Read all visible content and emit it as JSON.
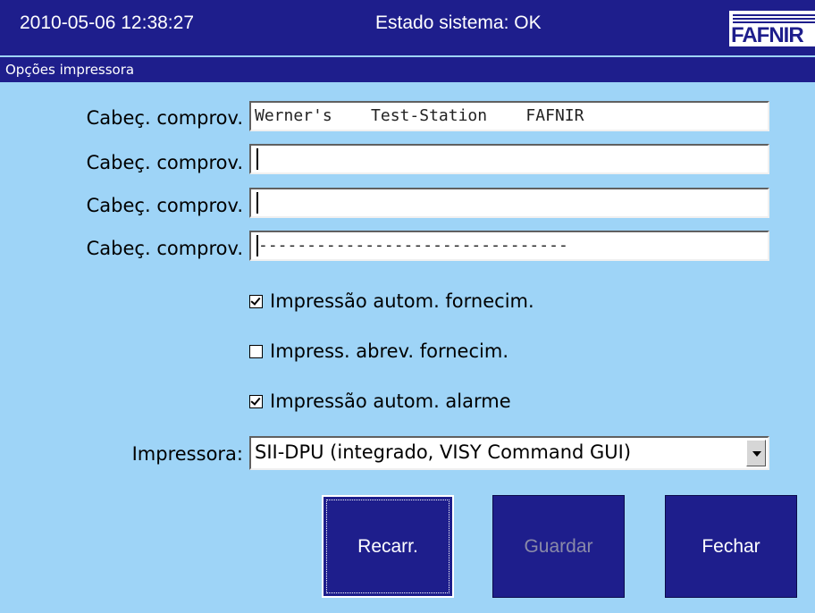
{
  "header": {
    "datetime": "2010-05-06  12:38:27",
    "status": "Estado sistema: OK",
    "logo_text": "FAFNIR"
  },
  "subtitle": "Opções impressora",
  "form": {
    "rows": [
      {
        "label": "Cabeç. comprov.",
        "value": "Werner's    Test-Station    FAFNIR"
      },
      {
        "label": "Cabeç. comprov.",
        "value": ""
      },
      {
        "label": "Cabeç. comprov.",
        "value": ""
      },
      {
        "label": "Cabeç. comprov.",
        "value": "--------------------------------"
      }
    ],
    "checkboxes": [
      {
        "label": "Impressão autom. fornecim.",
        "checked": true
      },
      {
        "label": "Impress. abrev. fornecim.",
        "checked": false
      },
      {
        "label": "Impressão autom. alarme",
        "checked": true
      }
    ],
    "printer": {
      "label": "Impressora:",
      "selected": "SII-DPU (integrado, VISY Command GUI)"
    }
  },
  "buttons": {
    "reload": "Recarr.",
    "save": "Guardar",
    "close": "Fechar"
  },
  "colors": {
    "header_bg": "#1e1e8c",
    "screen_bg": "#9ed4f7",
    "button_bg": "#1e1e8c"
  }
}
